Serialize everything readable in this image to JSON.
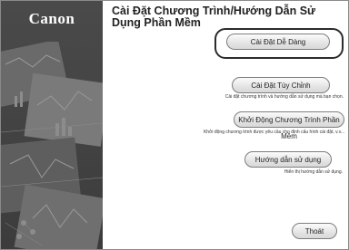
{
  "brand": {
    "logo_text": "Canon"
  },
  "header": {
    "title": "Cài Đặt Chương Trình/Hướng Dẫn Sử Dụng Phần Mềm"
  },
  "options": [
    {
      "label": "Cài Đặt Dễ Dàng",
      "description": ""
    },
    {
      "label": "Cài Đặt Tùy Chỉnh",
      "description": "Cài đặt chương trình và hướng dẫn sử dụng mà bạn chọn."
    },
    {
      "label": "Khởi Động Chương Trình Phần Mềm",
      "description": "Khởi động chương trình được yêu cầu cho định cấu hình cài đặt, v.v..."
    },
    {
      "label": "Hướng dẫn sử dụng",
      "description": "Hiển thị hướng dẫn sử dụng."
    }
  ],
  "footer": {
    "exit_label": "Thoát"
  },
  "colors": {
    "left_panel": "#444444",
    "button_face": "#e8e8e8",
    "focus_border": "#2c2c2c"
  }
}
